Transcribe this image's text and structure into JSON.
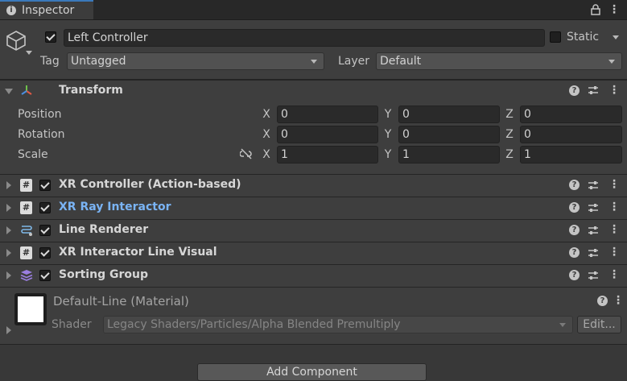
{
  "tab": {
    "title": "Inspector"
  },
  "header": {
    "object_name": "Left Controller",
    "active": true,
    "static_label": "Static",
    "static": false,
    "tag_label": "Tag",
    "tag_value": "Untagged",
    "layer_label": "Layer",
    "layer_value": "Default"
  },
  "transform": {
    "title": "Transform",
    "rows": [
      {
        "label": "Position",
        "x": "0",
        "y": "0",
        "z": "0"
      },
      {
        "label": "Rotation",
        "x": "0",
        "y": "0",
        "z": "0"
      },
      {
        "label": "Scale",
        "x": "1",
        "y": "1",
        "z": "1"
      }
    ],
    "axes": {
      "x": "X",
      "y": "Y",
      "z": "Z"
    }
  },
  "components": [
    {
      "title": "XR Controller (Action-based)",
      "icon": "script-icon",
      "enabled": true,
      "highlight": false
    },
    {
      "title": "XR Ray Interactor",
      "icon": "script-icon",
      "enabled": true,
      "highlight": true
    },
    {
      "title": "Line Renderer",
      "icon": "line-renderer-icon",
      "enabled": true,
      "highlight": false
    },
    {
      "title": "XR Interactor Line Visual",
      "icon": "script-icon",
      "enabled": true,
      "highlight": false
    },
    {
      "title": "Sorting Group",
      "icon": "sorting-group-icon",
      "enabled": true,
      "highlight": false
    }
  ],
  "material": {
    "name": "Default-Line (Material)",
    "shader_label": "Shader",
    "shader_value": "Legacy Shaders/Particles/Alpha Blended Premultiply",
    "edit_label": "Edit..."
  },
  "add_component_label": "Add Component",
  "colors": {
    "accent": "#3a79bb",
    "highlight_text": "#7ab4f5",
    "background": "#383838"
  }
}
